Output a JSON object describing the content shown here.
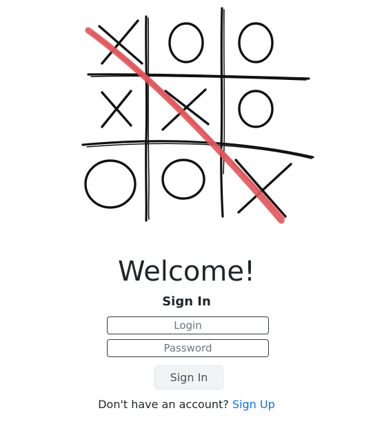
{
  "hero": {
    "board": [
      [
        "X",
        "O",
        "O"
      ],
      [
        "X",
        "X",
        "O"
      ],
      [
        "O",
        "O",
        "X"
      ]
    ],
    "board_ink_color": "#111111",
    "strike_color": "#e0555a"
  },
  "welcome": "Welcome!",
  "form": {
    "title": "Sign In",
    "login_placeholder": "Login",
    "password_placeholder": "Password",
    "submit_label": "Sign In"
  },
  "footer": {
    "prompt": "Don't have an account?",
    "link_label": "Sign Up"
  },
  "colors": {
    "text": "#212529",
    "link": "#0d6efd",
    "button_bg": "#f2f3f5"
  }
}
